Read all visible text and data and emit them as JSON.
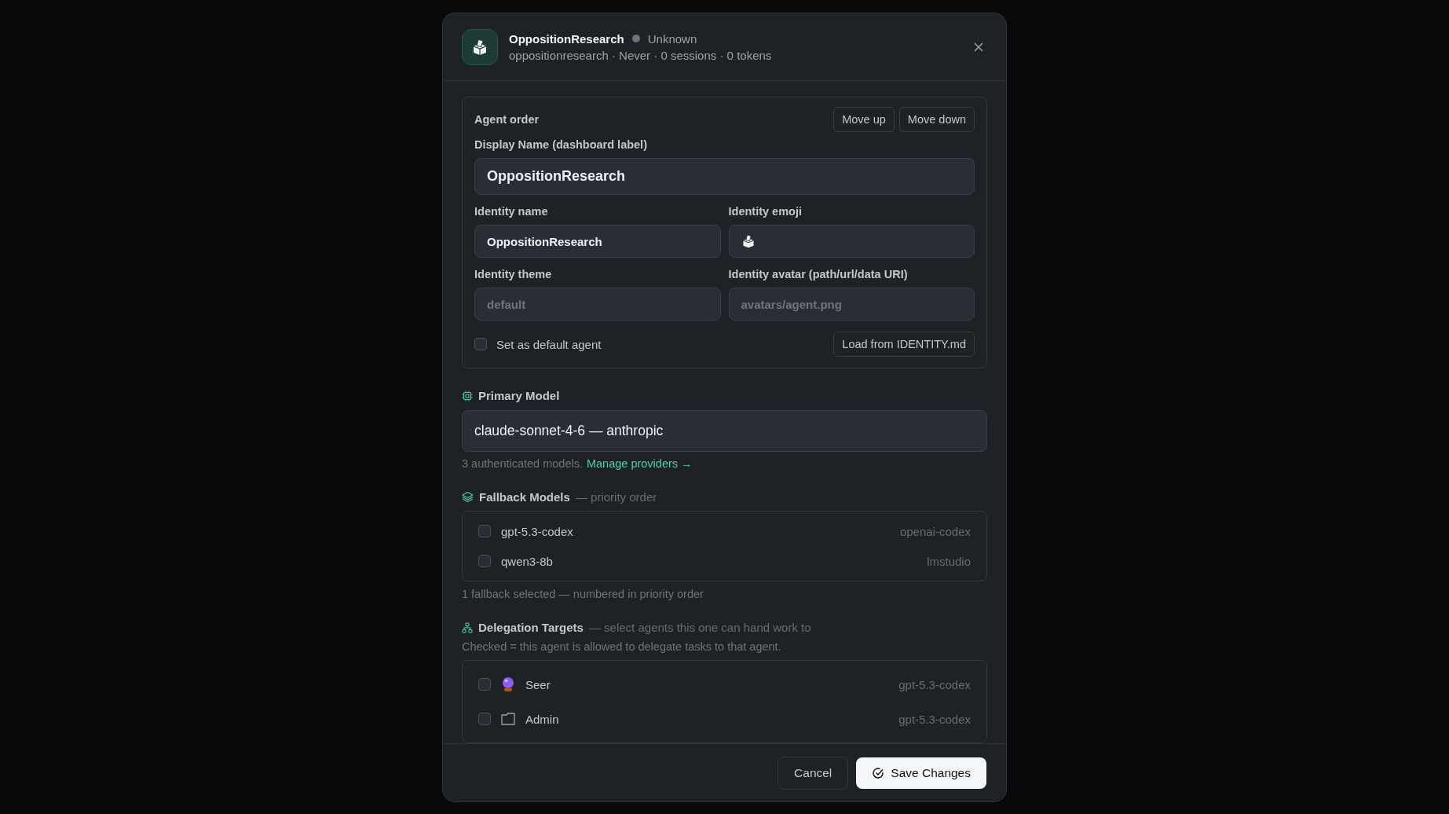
{
  "header": {
    "title": "OppositionResearch",
    "status": {
      "label": "Unknown",
      "color": "#6b7280"
    },
    "meta": "oppositionresearch · Never · 0 sessions · 0 tokens"
  },
  "identity_card": {
    "order_label": "Agent order",
    "order_buttons": [
      "Move up",
      "Move down"
    ],
    "display_name": {
      "label": "Display Name (dashboard label)",
      "value": "OppositionResearch"
    },
    "fields": [
      {
        "label": "Identity name",
        "value": "OppositionResearch",
        "kind": "text"
      },
      {
        "label": "Identity emoji",
        "kind": "emoji"
      },
      {
        "label": "Identity theme",
        "placeholder": "default",
        "kind": "text"
      },
      {
        "label": "Identity avatar (path/url/data URI)",
        "placeholder": "avatars/agent.png",
        "kind": "text"
      }
    ],
    "default_agent": {
      "label": "Set as default agent",
      "checked": false
    },
    "load_button": "Load from IDENTITY.md"
  },
  "primary_model": {
    "title": "Primary Model",
    "value": "claude-sonnet-4-6 — anthropic",
    "hint": "3 authenticated models.",
    "link": "Manage providers →"
  },
  "fallback_models": {
    "title": "Fallback Models",
    "subtitle": "— priority order",
    "items": [
      {
        "name": "gpt-5.3-codex",
        "provider": "openai-codex",
        "checked": false
      },
      {
        "name": "qwen3-8b",
        "provider": "lmstudio",
        "checked": false
      }
    ],
    "note": "1 fallback selected — numbered in priority order"
  },
  "delegation_targets": {
    "title": "Delegation Targets",
    "subtitle": "— select agents this one can hand work to",
    "note": "Checked = this agent is allowed to delegate tasks to that agent.",
    "items": [
      {
        "name": "Seer",
        "model": "gpt-5.3-codex",
        "checked": false,
        "kind": "crystal"
      },
      {
        "name": "Admin",
        "model": "gpt-5.3-codex",
        "checked": false,
        "kind": "folder"
      }
    ]
  },
  "footer": {
    "cancel": "Cancel",
    "save": "Save Changes"
  }
}
